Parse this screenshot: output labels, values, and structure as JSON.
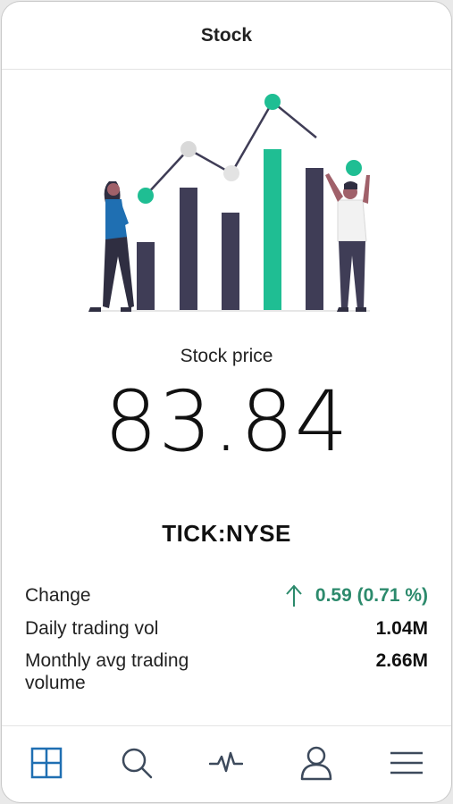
{
  "header": {
    "title": "Stock"
  },
  "price": {
    "label": "Stock price",
    "value": "83.84"
  },
  "ticker": "TICK:NYSE",
  "stats": [
    {
      "label": "Change",
      "value": "0.59 (0.71 %)",
      "trend": "up"
    },
    {
      "label": "Daily trading vol",
      "value": "1.04M"
    },
    {
      "label": "Monthly avg trading volume",
      "value": "2.66M"
    }
  ],
  "tabbar": [
    {
      "icon": "grid-icon",
      "active": true
    },
    {
      "icon": "search-icon",
      "active": false
    },
    {
      "icon": "activity-icon",
      "active": false
    },
    {
      "icon": "user-icon",
      "active": false
    },
    {
      "icon": "menu-icon",
      "active": false
    }
  ],
  "colors": {
    "accent_green": "#2c8a6c",
    "chart_green": "#1fbe93",
    "bar_dark": "#3f3d56",
    "active_tab": "#1f6fb2",
    "inactive_tab": "#3d4a5c"
  }
}
